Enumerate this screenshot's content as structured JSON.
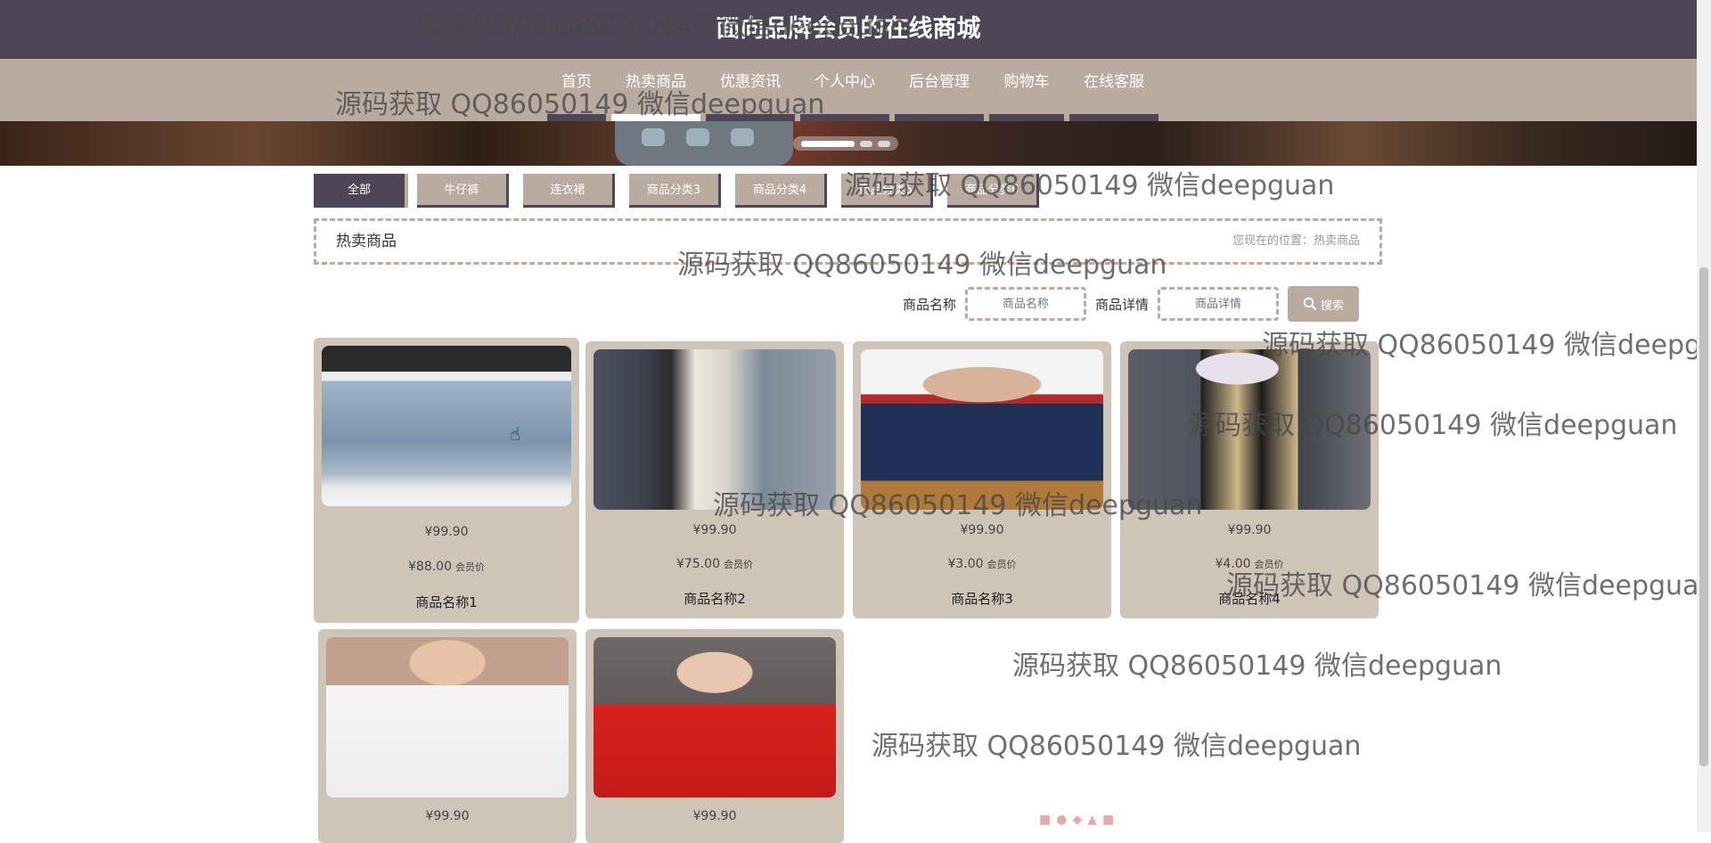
{
  "header": {
    "title": "面向品牌会员的在线商城"
  },
  "nav": [
    {
      "label": "首页"
    },
    {
      "label": "热卖商品",
      "active": true
    },
    {
      "label": "优惠资讯"
    },
    {
      "label": "个人中心"
    },
    {
      "label": "后台管理"
    },
    {
      "label": "购物车"
    },
    {
      "label": "在线客服"
    }
  ],
  "carousel": {
    "active_index": 0,
    "count": 3
  },
  "categories": [
    "全部",
    "牛仔裤",
    "连衣裙",
    "商品分类3",
    "商品分类4",
    "商品分类5",
    "商品分类6"
  ],
  "breadcrumb": {
    "title": "热卖商品",
    "position": "您现在的位置：热卖商品"
  },
  "search": {
    "name_label": "商品名称",
    "name_placeholder": "商品名称",
    "detail_label": "商品详情",
    "detail_placeholder": "商品详情",
    "button": "搜索"
  },
  "products": [
    {
      "price": "¥99.90",
      "vip_price": "¥88.00",
      "vip_label": "会员价",
      "name": "商品名称1"
    },
    {
      "price": "¥99.90",
      "vip_price": "¥75.00",
      "vip_label": "会员价",
      "name": "商品名称2"
    },
    {
      "price": "¥99.90",
      "vip_price": "¥3.00",
      "vip_label": "会员价",
      "name": "商品名称3"
    },
    {
      "price": "¥99.90",
      "vip_price": "¥4.00",
      "vip_label": "会员价",
      "name": "商品名称4"
    },
    {
      "price": "¥99.90"
    },
    {
      "price": "¥99.90"
    }
  ],
  "watermark": "源码获取 QQ86050149 微信deepguan",
  "colors": {
    "header": "#4e4656",
    "accent": "#b9aba0",
    "card": "#cfc4b8"
  }
}
